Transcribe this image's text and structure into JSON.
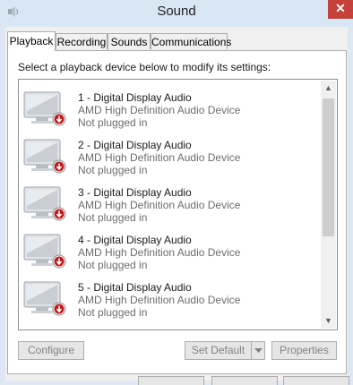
{
  "window": {
    "title": "Sound",
    "close_symbol": "✕"
  },
  "tabs": [
    {
      "label": "Playback",
      "active": true
    },
    {
      "label": "Recording",
      "active": false
    },
    {
      "label": "Sounds",
      "active": false
    },
    {
      "label": "Communications",
      "active": false
    }
  ],
  "instruction": "Select a playback device below to modify its settings:",
  "devices": [
    {
      "name": "1 - Digital Display Audio",
      "driver": "AMD High Definition Audio Device",
      "status": "Not plugged in"
    },
    {
      "name": "2 - Digital Display Audio",
      "driver": "AMD High Definition Audio Device",
      "status": "Not plugged in"
    },
    {
      "name": "3 - Digital Display Audio",
      "driver": "AMD High Definition Audio Device",
      "status": "Not plugged in"
    },
    {
      "name": "4 - Digital Display Audio",
      "driver": "AMD High Definition Audio Device",
      "status": "Not plugged in"
    },
    {
      "name": "5 - Digital Display Audio",
      "driver": "AMD High Definition Audio Device",
      "status": "Not plugged in"
    }
  ],
  "buttons": {
    "configure": "Configure",
    "set_default": "Set Default",
    "properties": "Properties"
  },
  "icons": {
    "device": "monitor-speaker-icon",
    "status_badge": "down-arrow-badge-icon",
    "app": "speaker-icon"
  },
  "colors": {
    "close": "#c7413b",
    "badge": "#c0191b",
    "disabled_text": "#838383"
  }
}
